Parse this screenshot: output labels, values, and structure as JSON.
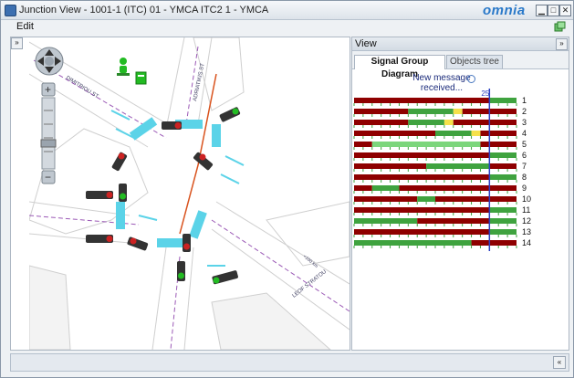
{
  "window": {
    "title": "Junction View - 1001-1 (ITC) 01 - YMCA ITC2 1 - YMCA",
    "logo": "omnia"
  },
  "menu": {
    "edit": "Edit"
  },
  "map": {
    "street_labels": [
      "DIMITRIOU ST",
      "ADRIATIKIS ST",
      "LEOF STRATOU",
      "<100 km"
    ],
    "colors": {
      "road_line": "#e4e4e4",
      "bus_lane": "#9b59b6",
      "crossing": "#5bd3e8",
      "route": "#d9531e",
      "signal_red": "#cc2222",
      "signal_green": "#22bb22"
    }
  },
  "view": {
    "title": "View",
    "tabs": [
      "Signal Group Diagram",
      "Objects tree"
    ],
    "active_tab": 0,
    "message": "New message received...",
    "time_marker": "25"
  },
  "chart_data": {
    "type": "timeline",
    "cycle_length_ticks": 18,
    "current_time_tick": 15,
    "colors": {
      "red": "#8e0000",
      "green": "#3fa33f",
      "amber": "#f5e14a",
      "flash_green": "#7bd67b"
    },
    "groups": [
      {
        "id": "1",
        "segments": [
          [
            0,
            15,
            "red"
          ],
          [
            15,
            18,
            "green"
          ]
        ]
      },
      {
        "id": "2",
        "segments": [
          [
            0,
            6,
            "red"
          ],
          [
            6,
            11,
            "green"
          ],
          [
            11,
            12,
            "amber"
          ],
          [
            12,
            18,
            "red"
          ]
        ]
      },
      {
        "id": "3",
        "segments": [
          [
            0,
            6,
            "red"
          ],
          [
            6,
            10,
            "green"
          ],
          [
            10,
            11,
            "amber"
          ],
          [
            11,
            18,
            "red"
          ]
        ]
      },
      {
        "id": "4",
        "segments": [
          [
            0,
            9,
            "red"
          ],
          [
            9,
            13,
            "green"
          ],
          [
            13,
            14,
            "amber"
          ],
          [
            14,
            18,
            "red"
          ]
        ]
      },
      {
        "id": "5",
        "segments": [
          [
            0,
            2,
            "red"
          ],
          [
            2,
            14,
            "flash_green"
          ],
          [
            14,
            18,
            "red"
          ]
        ]
      },
      {
        "id": "6",
        "segments": [
          [
            0,
            15,
            "red"
          ],
          [
            15,
            18,
            "green"
          ]
        ]
      },
      {
        "id": "7",
        "segments": [
          [
            0,
            8,
            "red"
          ],
          [
            8,
            15,
            "green"
          ],
          [
            15,
            18,
            "red"
          ]
        ]
      },
      {
        "id": "8",
        "segments": [
          [
            0,
            15,
            "red"
          ],
          [
            15,
            18,
            "green"
          ]
        ]
      },
      {
        "id": "9",
        "segments": [
          [
            0,
            2,
            "red"
          ],
          [
            2,
            5,
            "green"
          ],
          [
            5,
            18,
            "red"
          ]
        ]
      },
      {
        "id": "10",
        "segments": [
          [
            0,
            7,
            "red"
          ],
          [
            7,
            9,
            "green"
          ],
          [
            9,
            18,
            "red"
          ]
        ]
      },
      {
        "id": "11",
        "segments": [
          [
            0,
            15,
            "red"
          ],
          [
            15,
            18,
            "green"
          ]
        ]
      },
      {
        "id": "12",
        "segments": [
          [
            0,
            7,
            "green"
          ],
          [
            7,
            15,
            "red"
          ],
          [
            15,
            18,
            "green"
          ]
        ]
      },
      {
        "id": "13",
        "segments": [
          [
            0,
            15,
            "red"
          ],
          [
            15,
            18,
            "green"
          ]
        ]
      },
      {
        "id": "14",
        "segments": [
          [
            0,
            13,
            "green"
          ],
          [
            13,
            18,
            "red"
          ]
        ]
      }
    ]
  }
}
